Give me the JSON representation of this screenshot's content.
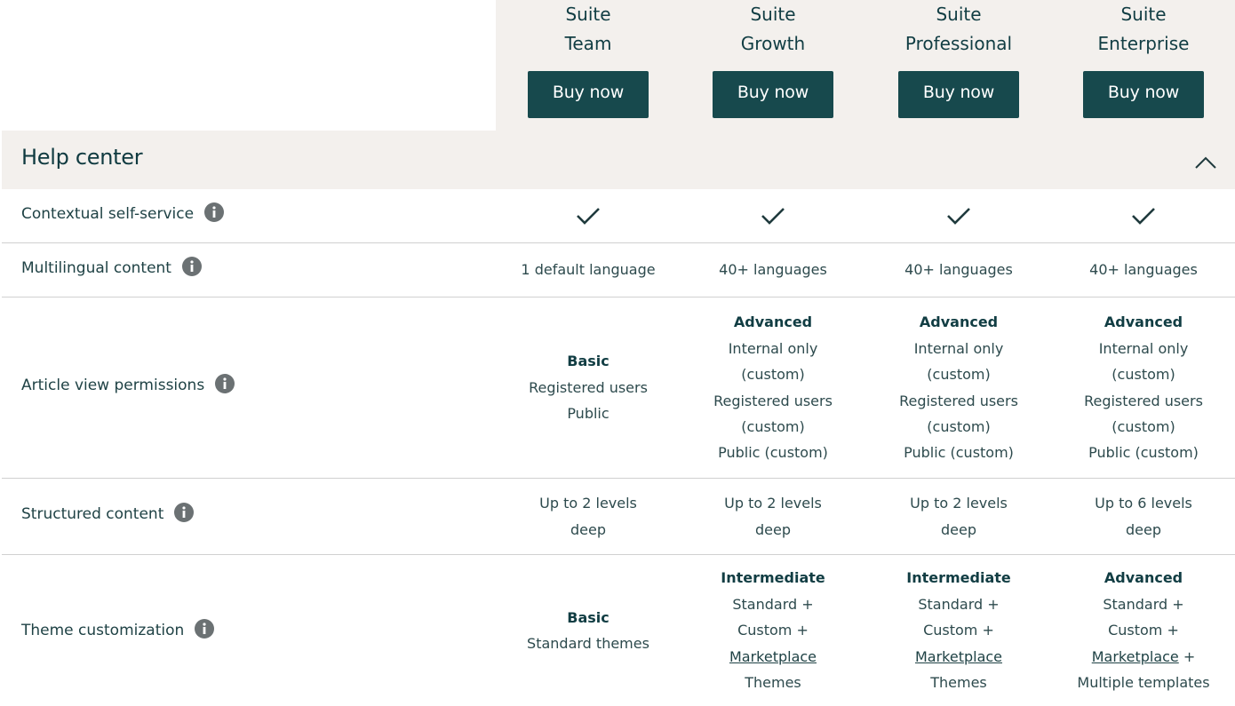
{
  "plans": [
    {
      "prefix": "Suite",
      "name": "Team",
      "buy_label": "Buy now"
    },
    {
      "prefix": "Suite",
      "name": "Growth",
      "buy_label": "Buy now"
    },
    {
      "prefix": "Suite",
      "name": "Professional",
      "buy_label": "Buy now"
    },
    {
      "prefix": "Suite",
      "name": "Enterprise",
      "buy_label": "Buy now"
    }
  ],
  "section": {
    "title": "Help center",
    "toggle_icon": "chevron-up-icon",
    "expanded": true
  },
  "colors": {
    "brand": "#17494d",
    "header_bg": "#f3f0ed",
    "info_icon": "#6b7173",
    "divider": "#d0d0d0"
  },
  "features": [
    {
      "label": "Contextual self-service",
      "info_icon": "info-icon",
      "values": [
        {
          "check": true
        },
        {
          "check": true
        },
        {
          "check": true
        },
        {
          "check": true
        }
      ]
    },
    {
      "label": "Multilingual content",
      "info_icon": "info-icon",
      "values": [
        {
          "lines": [
            "1 default language"
          ]
        },
        {
          "lines": [
            "40+ languages"
          ]
        },
        {
          "lines": [
            "40+ languages"
          ]
        },
        {
          "lines": [
            "40+ languages"
          ]
        }
      ]
    },
    {
      "label": "Article view permissions",
      "info_icon": "info-icon",
      "values": [
        {
          "heading": "Basic",
          "lines": [
            "Registered users",
            "Public"
          ]
        },
        {
          "heading": "Advanced",
          "lines": [
            "Internal only",
            "(custom)",
            "Registered users",
            "(custom)",
            "Public (custom)"
          ]
        },
        {
          "heading": "Advanced",
          "lines": [
            "Internal only",
            "(custom)",
            "Registered users",
            "(custom)",
            "Public (custom)"
          ]
        },
        {
          "heading": "Advanced",
          "lines": [
            "Internal only",
            "(custom)",
            "Registered users",
            "(custom)",
            "Public (custom)"
          ]
        }
      ]
    },
    {
      "label": "Structured content",
      "info_icon": "info-icon",
      "values": [
        {
          "lines": [
            "Up to 2 levels",
            "deep"
          ]
        },
        {
          "lines": [
            "Up to 2 levels",
            "deep"
          ]
        },
        {
          "lines": [
            "Up to 2 levels",
            "deep"
          ]
        },
        {
          "lines": [
            "Up to 6 levels",
            "deep"
          ]
        }
      ]
    },
    {
      "label": "Theme customization",
      "info_icon": "info-icon",
      "values": [
        {
          "heading": "Basic",
          "lines": [
            "Standard themes"
          ]
        },
        {
          "heading": "Intermediate",
          "lines": [
            "Standard +",
            "Custom +",
            {
              "link": "Marketplace"
            },
            "Themes"
          ]
        },
        {
          "heading": "Intermediate",
          "lines": [
            "Standard +",
            "Custom +",
            {
              "link": "Marketplace"
            },
            "Themes"
          ]
        },
        {
          "heading": "Advanced",
          "lines": [
            "Standard +",
            "Custom +",
            {
              "link": "Marketplace",
              "suffix": " +"
            },
            "Multiple templates"
          ]
        }
      ]
    }
  ]
}
